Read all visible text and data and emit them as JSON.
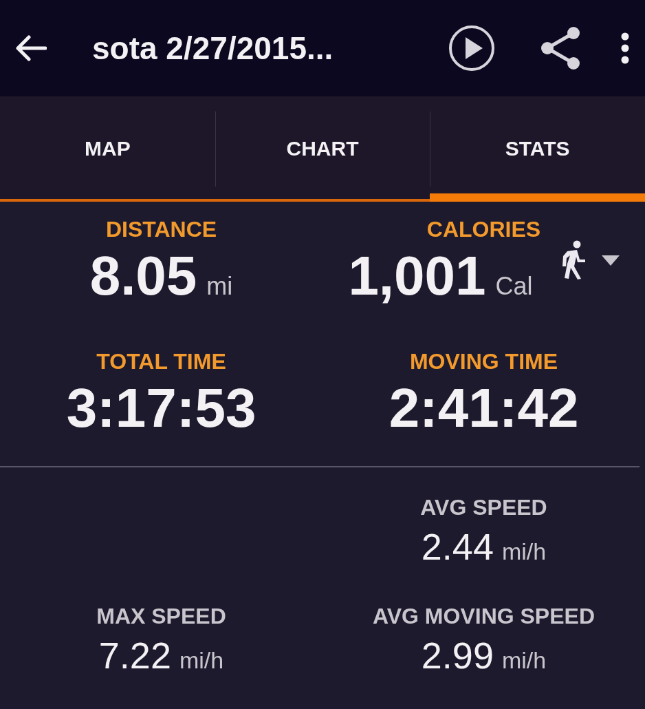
{
  "app_bar": {
    "title": "sota 2/27/2015..."
  },
  "tabs": [
    {
      "label": "MAP",
      "selected": false
    },
    {
      "label": "CHART",
      "selected": false
    },
    {
      "label": "STATS",
      "selected": true
    }
  ],
  "primary_stats": [
    {
      "label": "DISTANCE",
      "value": "8.05",
      "unit": "mi"
    },
    {
      "label": "CALORIES",
      "value": "1,001",
      "unit": "Cal",
      "activity_picker": true
    },
    {
      "label": "TOTAL TIME",
      "value": "3:17:53"
    },
    {
      "label": "MOVING TIME",
      "value": "2:41:42"
    }
  ],
  "secondary_stats": [
    {
      "right": {
        "label": "AVG SPEED",
        "value": "2.44",
        "unit": "mi/h"
      }
    },
    {
      "left": {
        "label": "MAX SPEED",
        "value": "7.22",
        "unit": "mi/h"
      },
      "right": {
        "label": "AVG MOVING SPEED",
        "value": "2.99",
        "unit": "mi/h"
      }
    }
  ]
}
